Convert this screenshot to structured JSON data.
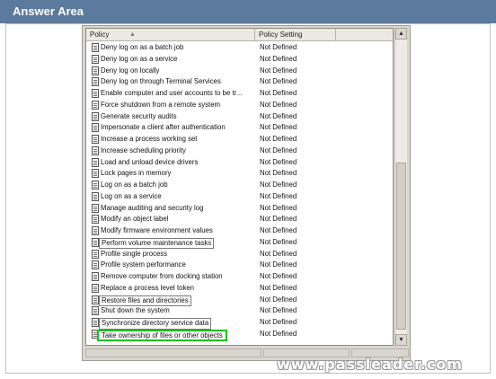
{
  "window": {
    "title": "Answer Area"
  },
  "table": {
    "columns": [
      {
        "label": "Policy",
        "sort_indicator": "▲"
      },
      {
        "label": "Policy Setting"
      }
    ],
    "rows": [
      {
        "policy": "Deny log on as a batch job",
        "setting": "Not Defined"
      },
      {
        "policy": "Deny log on as a service",
        "setting": "Not Defined"
      },
      {
        "policy": "Deny log on locally",
        "setting": "Not Defined"
      },
      {
        "policy": "Deny log on through Terminal Services",
        "setting": "Not Defined"
      },
      {
        "policy": "Enable computer and user accounts to be tr...",
        "setting": "Not Defined"
      },
      {
        "policy": "Force shutdown from a remote system",
        "setting": "Not Defined"
      },
      {
        "policy": "Generate security audits",
        "setting": "Not Defined"
      },
      {
        "policy": "Impersonate a client after authentication",
        "setting": "Not Defined"
      },
      {
        "policy": "Increase a process working set",
        "setting": "Not Defined"
      },
      {
        "policy": "Increase scheduling priority",
        "setting": "Not Defined"
      },
      {
        "policy": "Load and unload device drivers",
        "setting": "Not Defined"
      },
      {
        "policy": "Lock pages in memory",
        "setting": "Not Defined"
      },
      {
        "policy": "Log on as a batch job",
        "setting": "Not Defined"
      },
      {
        "policy": "Log on as a service",
        "setting": "Not Defined"
      },
      {
        "policy": "Manage auditing and security log",
        "setting": "Not Defined"
      },
      {
        "policy": "Modify an object label",
        "setting": "Not Defined"
      },
      {
        "policy": "Modify firmware environment values",
        "setting": "Not Defined"
      },
      {
        "policy": "Perform volume maintenance tasks",
        "setting": "Not Defined"
      },
      {
        "policy": "Profile single process",
        "setting": "Not Defined"
      },
      {
        "policy": "Profile system performance",
        "setting": "Not Defined"
      },
      {
        "policy": "Remove computer from docking station",
        "setting": "Not Defined"
      },
      {
        "policy": "Replace a process level token",
        "setting": "Not Defined"
      },
      {
        "policy": "Restore files and directories",
        "setting": "Not Defined"
      },
      {
        "policy": "Shut down the system",
        "setting": "Not Defined"
      },
      {
        "policy": "Synchronize directory service data",
        "setting": "Not Defined"
      },
      {
        "policy": "Take ownership of files or other objects",
        "setting": "Not Defined"
      }
    ]
  },
  "scrollbar": {
    "up_arrow": "▲",
    "down_arrow": "▼"
  },
  "watermark": "www.passleader.com",
  "colors": {
    "title_bar": "#5b7a9e",
    "selection_border": "#1fbf1f"
  }
}
